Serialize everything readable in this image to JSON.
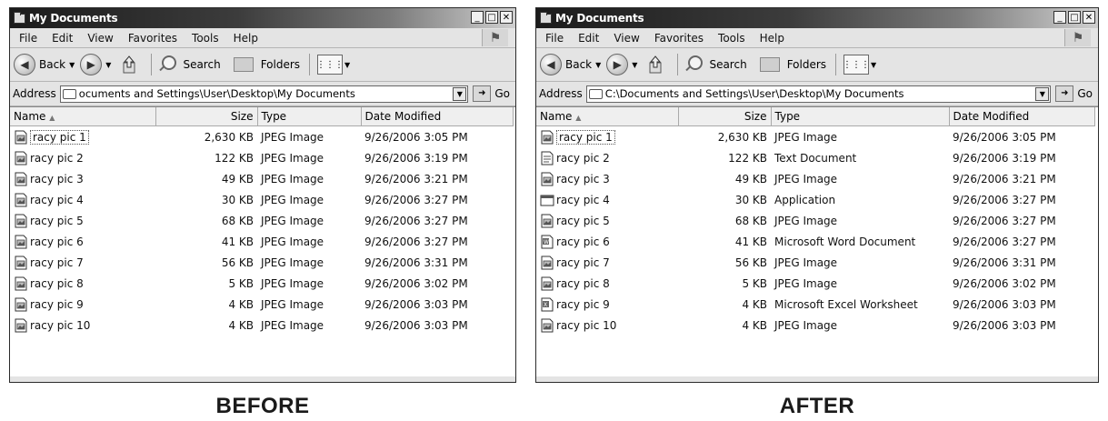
{
  "panels": {
    "before": {
      "caption": "BEFORE",
      "title": "My Documents",
      "menu": [
        "File",
        "Edit",
        "View",
        "Favorites",
        "Tools",
        "Help"
      ],
      "toolbar": {
        "back": "Back",
        "search": "Search",
        "folders": "Folders"
      },
      "address_label": "Address",
      "address_value": "ocuments and Settings\\User\\Desktop\\My Documents",
      "go": "Go",
      "columns": [
        "Name",
        "Size",
        "Type",
        "Date Modified"
      ],
      "rows": [
        {
          "name": "racy pic 1",
          "size": "2,630 KB",
          "type": "JPEG Image",
          "date": "9/26/2006 3:05 PM",
          "icon": "image-file-icon"
        },
        {
          "name": "racy pic 2",
          "size": "122 KB",
          "type": "JPEG Image",
          "date": "9/26/2006 3:19 PM",
          "icon": "image-file-icon"
        },
        {
          "name": "racy pic 3",
          "size": "49 KB",
          "type": "JPEG Image",
          "date": "9/26/2006 3:21 PM",
          "icon": "image-file-icon"
        },
        {
          "name": "racy pic 4",
          "size": "30 KB",
          "type": "JPEG Image",
          "date": "9/26/2006 3:27 PM",
          "icon": "image-file-icon"
        },
        {
          "name": "racy pic 5",
          "size": "68 KB",
          "type": "JPEG Image",
          "date": "9/26/2006 3:27 PM",
          "icon": "image-file-icon"
        },
        {
          "name": "racy pic 6",
          "size": "41 KB",
          "type": "JPEG Image",
          "date": "9/26/2006 3:27 PM",
          "icon": "image-file-icon"
        },
        {
          "name": "racy pic 7",
          "size": "56 KB",
          "type": "JPEG Image",
          "date": "9/26/2006 3:31 PM",
          "icon": "image-file-icon"
        },
        {
          "name": "racy pic 8",
          "size": "5 KB",
          "type": "JPEG Image",
          "date": "9/26/2006 3:02 PM",
          "icon": "image-file-icon"
        },
        {
          "name": "racy pic 9",
          "size": "4 KB",
          "type": "JPEG Image",
          "date": "9/26/2006 3:03 PM",
          "icon": "image-file-icon"
        },
        {
          "name": "racy pic 10",
          "size": "4 KB",
          "type": "JPEG Image",
          "date": "9/26/2006 3:03 PM",
          "icon": "image-file-icon"
        }
      ]
    },
    "after": {
      "caption": "AFTER",
      "title": "My Documents",
      "menu": [
        "File",
        "Edit",
        "View",
        "Favorites",
        "Tools",
        "Help"
      ],
      "toolbar": {
        "back": "Back",
        "search": "Search",
        "folders": "Folders"
      },
      "address_label": "Address",
      "address_value": "C:\\Documents and Settings\\User\\Desktop\\My Documents",
      "go": "Go",
      "columns": [
        "Name",
        "Size",
        "Type",
        "Date Modified"
      ],
      "rows": [
        {
          "name": "racy pic 1",
          "size": "2,630 KB",
          "type": "JPEG Image",
          "date": "9/26/2006 3:05 PM",
          "icon": "image-file-icon"
        },
        {
          "name": "racy pic 2",
          "size": "122 KB",
          "type": "Text Document",
          "date": "9/26/2006 3:19 PM",
          "icon": "text-file-icon"
        },
        {
          "name": "racy pic 3",
          "size": "49 KB",
          "type": "JPEG Image",
          "date": "9/26/2006 3:21 PM",
          "icon": "image-file-icon"
        },
        {
          "name": "racy pic 4",
          "size": "30 KB",
          "type": "Application",
          "date": "9/26/2006 3:27 PM",
          "icon": "application-icon"
        },
        {
          "name": "racy pic 5",
          "size": "68 KB",
          "type": "JPEG Image",
          "date": "9/26/2006 3:27 PM",
          "icon": "image-file-icon"
        },
        {
          "name": "racy pic 6",
          "size": "41 KB",
          "type": "Microsoft Word Document",
          "date": "9/26/2006 3:27 PM",
          "icon": "word-document-icon"
        },
        {
          "name": "racy pic 7",
          "size": "56 KB",
          "type": "JPEG Image",
          "date": "9/26/2006 3:31 PM",
          "icon": "image-file-icon"
        },
        {
          "name": "racy pic 8",
          "size": "5 KB",
          "type": "JPEG Image",
          "date": "9/26/2006 3:02 PM",
          "icon": "image-file-icon"
        },
        {
          "name": "racy pic 9",
          "size": "4 KB",
          "type": "Microsoft Excel Worksheet",
          "date": "9/26/2006 3:03 PM",
          "icon": "excel-worksheet-icon"
        },
        {
          "name": "racy pic 10",
          "size": "4 KB",
          "type": "JPEG Image",
          "date": "9/26/2006 3:03 PM",
          "icon": "image-file-icon"
        }
      ]
    }
  }
}
